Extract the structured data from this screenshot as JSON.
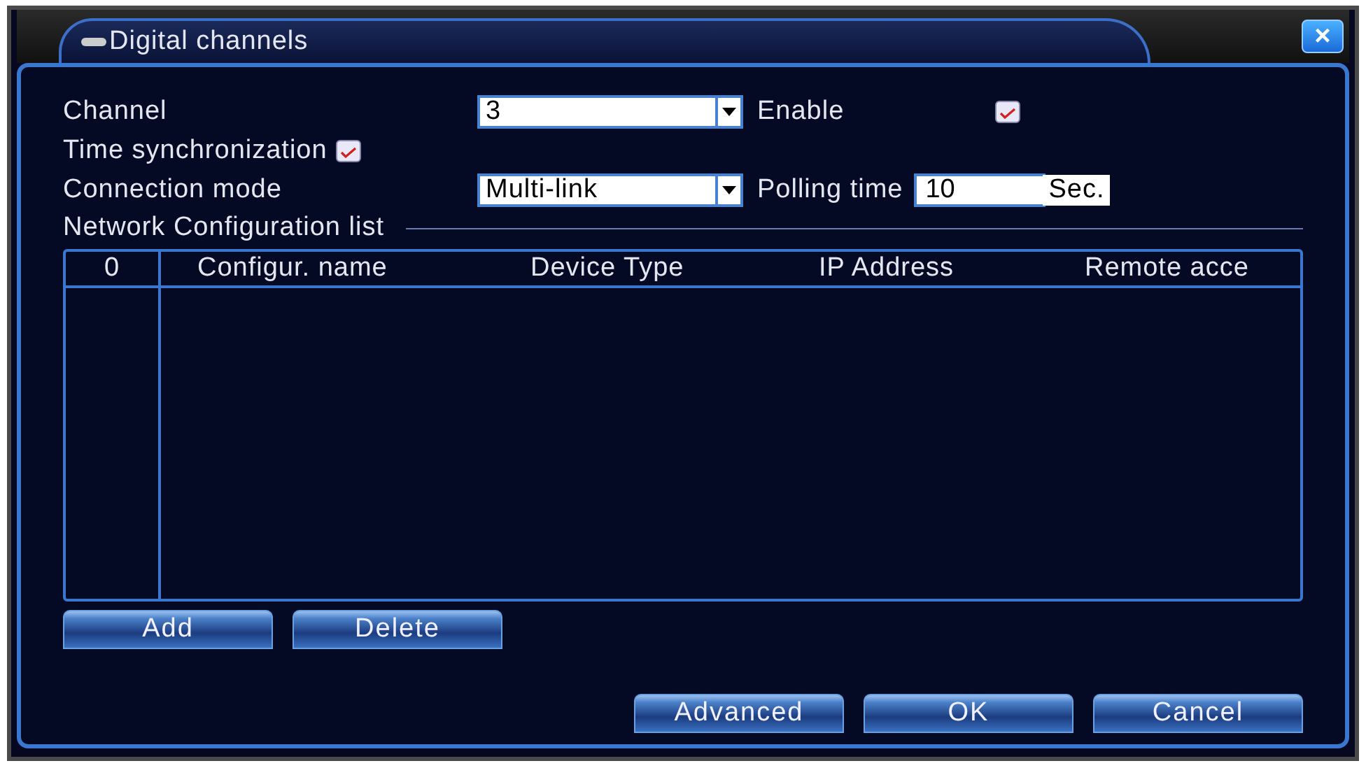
{
  "window": {
    "title": "Digital channels",
    "close": "×"
  },
  "form": {
    "channel": {
      "label": "Channel",
      "value": "3"
    },
    "enable": {
      "label": "Enable",
      "checked": true
    },
    "time_sync": {
      "label": "Time synchronization",
      "checked": true
    },
    "connection_mode": {
      "label": "Connection mode",
      "value": "Multi-link"
    },
    "polling": {
      "label": "Polling time",
      "value": "10",
      "unit": "Sec."
    }
  },
  "table": {
    "title": "Network Configuration list",
    "columns": [
      "0",
      "Configur. name",
      "Device Type",
      "IP Address",
      "Remote acce"
    ]
  },
  "table_buttons": [
    "Add",
    "Delete"
  ],
  "buttons": [
    "Advanced",
    "OK",
    "Cancel"
  ]
}
